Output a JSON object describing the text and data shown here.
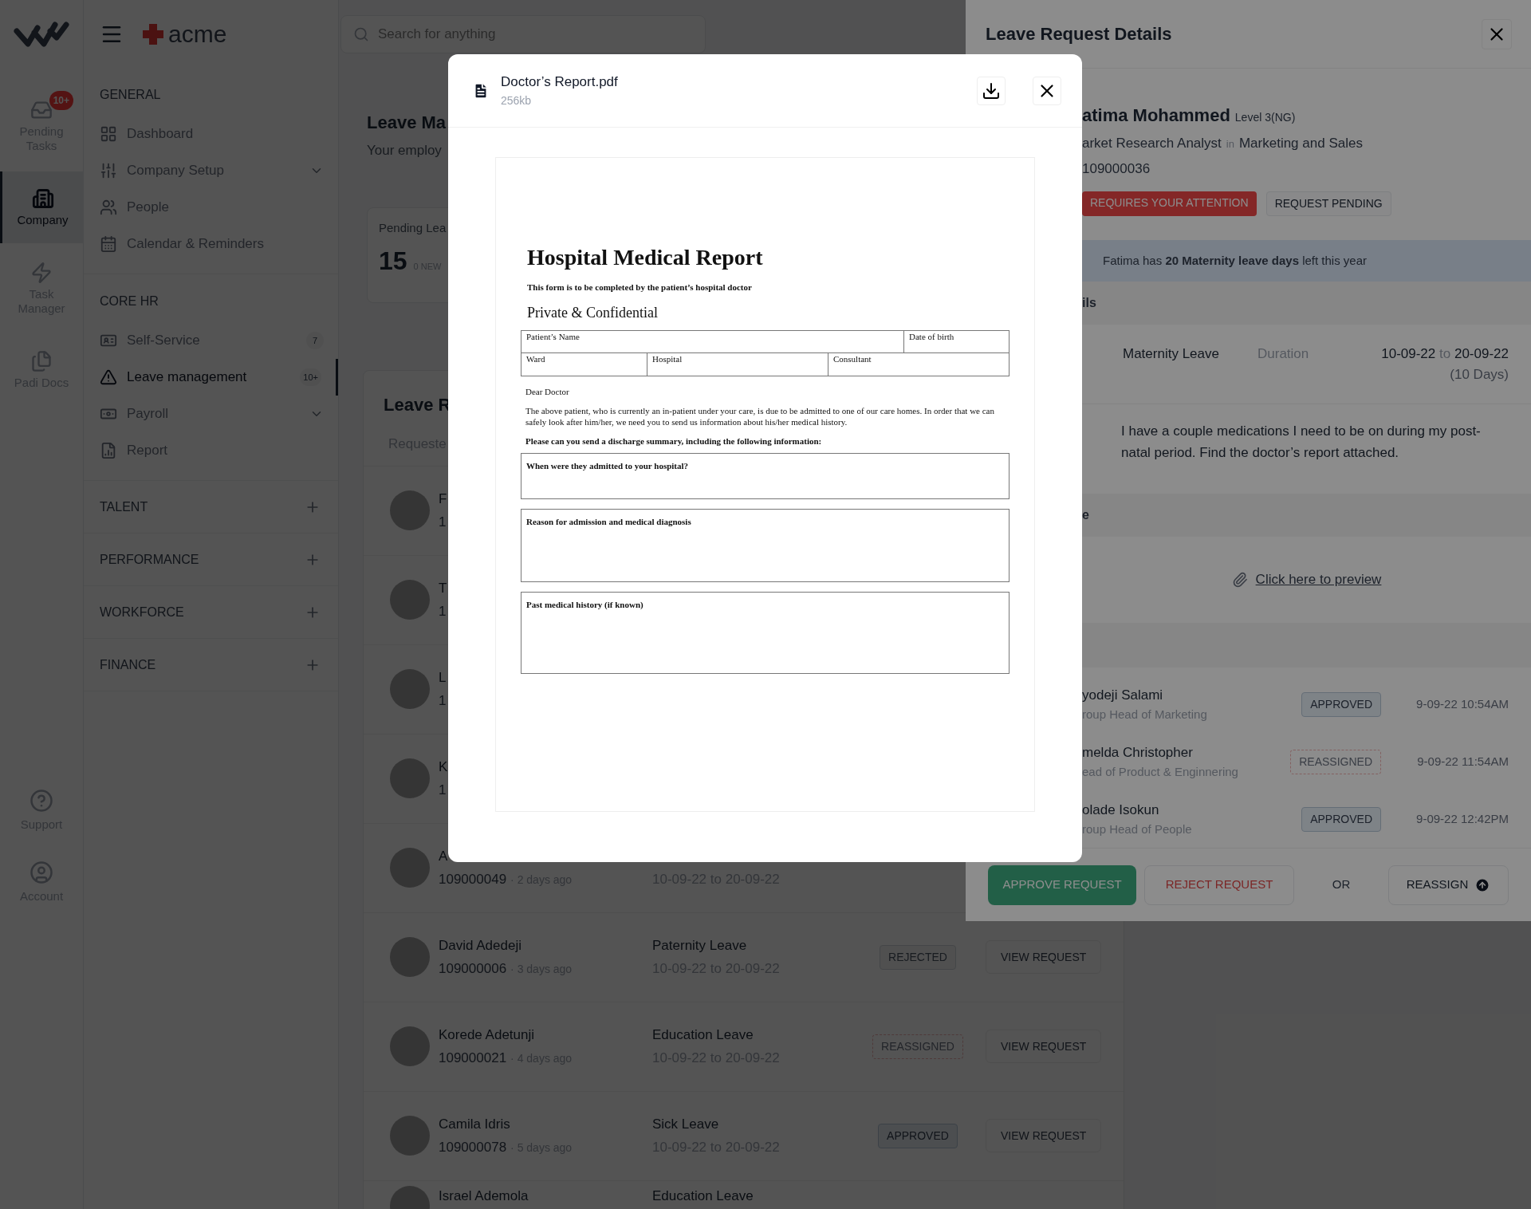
{
  "rail": {
    "items": [
      {
        "label": "Pending Tasks",
        "badge": "10+",
        "selected": false
      },
      {
        "label": "Company",
        "selected": true
      },
      {
        "label": "Task Manager",
        "selected": false
      },
      {
        "label": "Padi Docs",
        "selected": false
      }
    ],
    "bottom_items": [
      {
        "label": "Support"
      },
      {
        "label": "Account"
      }
    ]
  },
  "header": {
    "brand": "acme",
    "search": {
      "placeholder": "Search for anything"
    }
  },
  "nav": {
    "sections": [
      {
        "title": "GENERAL",
        "expanded": true,
        "items": [
          {
            "label": "Dashboard",
            "selected": false,
            "expandable": false
          },
          {
            "label": "Company Setup",
            "selected": false,
            "expandable": true
          },
          {
            "label": "People",
            "selected": false,
            "expandable": false
          },
          {
            "label": "Calendar & Reminders",
            "selected": false,
            "expandable": false
          }
        ]
      },
      {
        "title": "CORE HR",
        "expanded": true,
        "items": [
          {
            "label": "Self-Service",
            "selected": false,
            "expandable": false,
            "count": "7"
          },
          {
            "label": "Leave management",
            "selected": true,
            "expandable": false,
            "count": "10+"
          },
          {
            "label": "Payroll",
            "selected": false,
            "expandable": true
          },
          {
            "label": "Report",
            "selected": false,
            "expandable": false
          }
        ]
      },
      {
        "title": "TALENT",
        "expanded": false
      },
      {
        "title": "PERFORMANCE",
        "expanded": false
      },
      {
        "title": "WORKFORCE",
        "expanded": false
      },
      {
        "title": "FINANCE",
        "expanded": false
      }
    ]
  },
  "main": {
    "title": "Leave Ma",
    "subtitle": "Your employ",
    "stat": {
      "label": "Pending Lea",
      "value": "15",
      "note": "0 NEW"
    },
    "list": {
      "title": "Leave R",
      "column_1": "Requeste",
      "rows": [
        {
          "name": "F",
          "id": "1"
        },
        {
          "name": "T",
          "id": "1"
        },
        {
          "name": "L",
          "id": "1"
        },
        {
          "name": "K",
          "id": "1"
        },
        {
          "name": "A",
          "id": "109000049",
          "age": "· 2 days ago",
          "dates": "10-09-22 to 20-09-22"
        },
        {
          "name": "David Adedeji",
          "id": "109000006",
          "age": "· 3 days ago",
          "type": "Paternity Leave",
          "dates": "10-09-22 to 20-09-22",
          "status": "REJECTED",
          "kind": "rejected",
          "action": "VIEW REQUEST"
        },
        {
          "name": "Korede Adetunji",
          "id": "109000021",
          "age": "· 4 days ago",
          "type": "Education Leave",
          "dates": "10-09-22 to 20-09-22",
          "status": "REASSIGNED",
          "kind": "reassigned",
          "action": "VIEW REQUEST"
        },
        {
          "name": "Camila Idris",
          "id": "109000078",
          "age": "· 5 days ago",
          "type": "Sick Leave",
          "dates": "10-09-22 to 20-09-22",
          "status": "APPROVED",
          "kind": "approved",
          "action": "VIEW REQUEST"
        },
        {
          "name": "Israel Ademola",
          "type": "Education Leave"
        }
      ]
    }
  },
  "drawer": {
    "title": "Leave Request Details",
    "employee": {
      "name": "atima Mohammed",
      "level": "Level 3(NG)",
      "role": "arket Research Analyst",
      "connector": "in",
      "department": "Marketing and Sales",
      "id": "109000036"
    },
    "badges": [
      {
        "label": "REQUIRES YOUR ATTENTION",
        "kind": "alert"
      },
      {
        "label": "REQUEST PENDING",
        "kind": "neutral"
      }
    ],
    "notice": "Fatima has **20 Maternity leave days** left this year",
    "details_heading": "ils",
    "leave_type": "Maternity Leave",
    "duration_label": "Duration",
    "start": "10-09-22",
    "to": "to",
    "end": "20-09-22",
    "days": "(10 Days)",
    "reason": "I have a couple medications I need to be on during my post-natal period. Find the doctor’s report attached.",
    "attachment_heading": "e",
    "attachment_link": "Click here to preview",
    "approvals": [
      {
        "name": "yodeji Salami",
        "role": "roup Head of Marketing",
        "status": "APPROVED",
        "kind": "approved",
        "time": "9-09-22 10:54AM"
      },
      {
        "name": "melda Christopher",
        "role": "ead of Product & Enginnering",
        "status": "REASSIGNED",
        "kind": "reassigned",
        "time": "9-09-22 11:54AM"
      },
      {
        "name": "olade Isokun",
        "role": "roup Head of People",
        "status": "APPROVED",
        "kind": "approved",
        "time": "9-09-22 12:42PM"
      }
    ],
    "actions": [
      {
        "label": "APPROVE REQUEST",
        "kind": "primary"
      },
      {
        "label": "REJECT REQUEST",
        "kind": "danger"
      },
      {
        "label": "OR",
        "kind": "separator"
      },
      {
        "label": "REASSIGN",
        "kind": "reassign"
      }
    ]
  },
  "modal": {
    "file": {
      "name": "Doctor’s Report.pdf",
      "size": "256kb"
    },
    "document": {
      "title": "Hospital Medical Report",
      "subtitle": "This form is to be completed by the patient’s hospital doctor",
      "confidential": "Private & Confidential",
      "fields_row_1": [
        "Patient’s Name",
        "Date of birth"
      ],
      "fields_row_2": [
        "Ward",
        "Hospital",
        "Consultant"
      ],
      "salutation": "Dear Doctor",
      "body": "The above patient, who is currently an in-patient under your care, is due to be admitted to one of our care homes.  In order that we can safely look after him/her, we need you to send us information about his/her medical history.",
      "request": "Please can you send a discharge summary, including the following information:",
      "questions": [
        "When were they admitted to your hospital?",
        "Reason for admission and medical diagnosis",
        "Past medical history (if known)"
      ]
    }
  }
}
